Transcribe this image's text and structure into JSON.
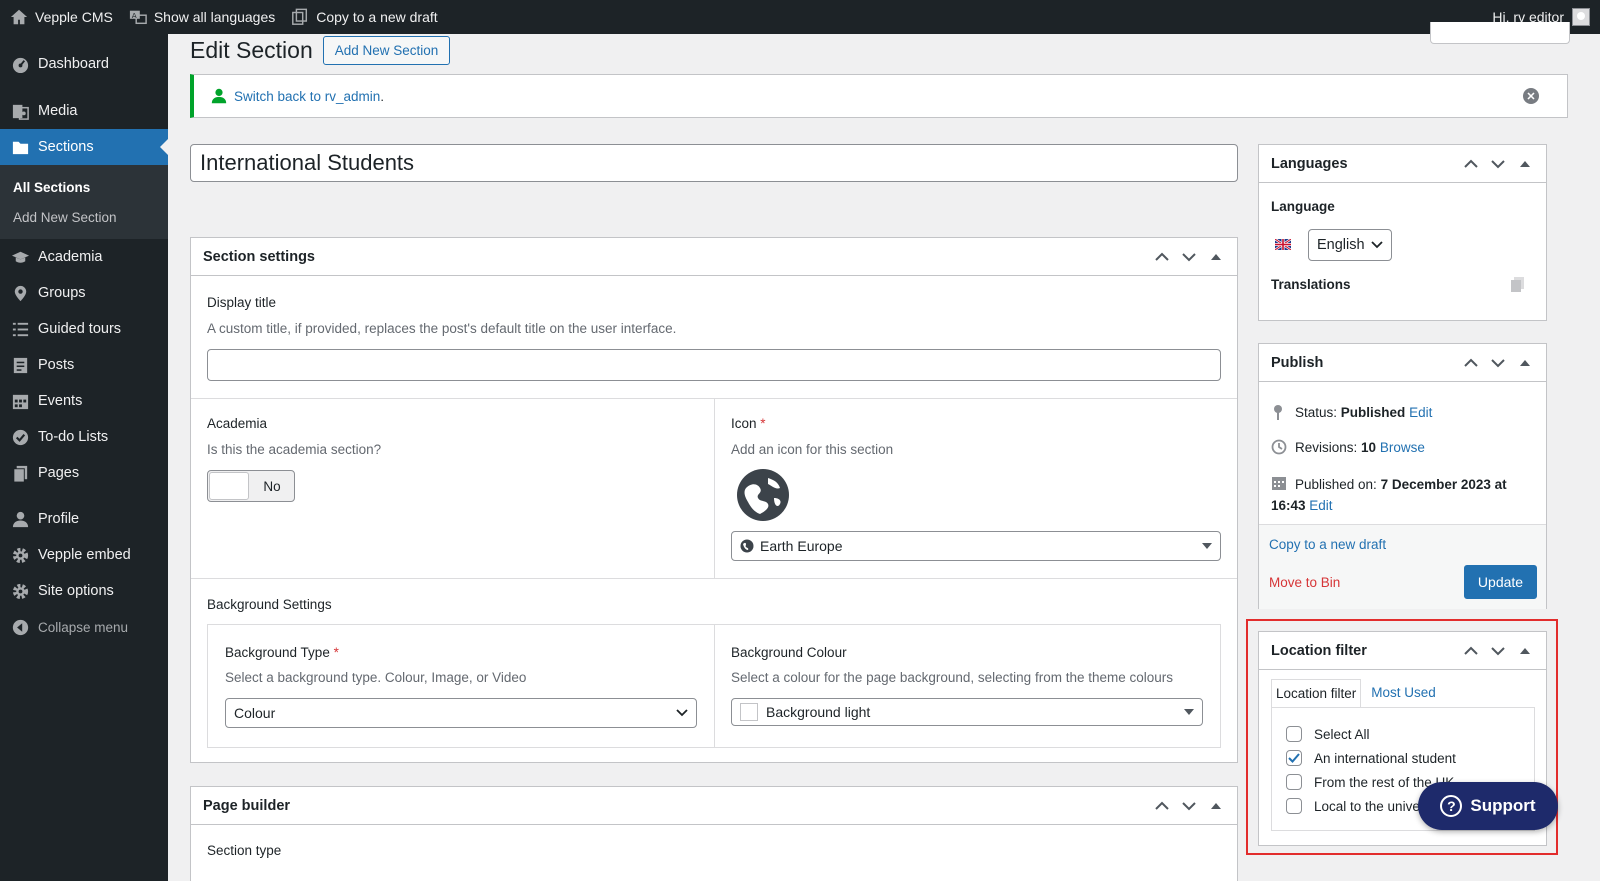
{
  "adminbar": {
    "site_name": "Vepple CMS",
    "languages": "Show all languages",
    "copy_draft": "Copy to a new draft",
    "greeting": "Hi, rv editor"
  },
  "sidebar": {
    "items": [
      {
        "label": "Dashboard",
        "icon": "dashboard-icon"
      },
      {
        "label": "Media",
        "icon": "media-icon"
      },
      {
        "label": "Sections",
        "icon": "folder-icon"
      },
      {
        "label": "Academia",
        "icon": "graduation-cap-icon"
      },
      {
        "label": "Groups",
        "icon": "location-pin-icon"
      },
      {
        "label": "Guided tours",
        "icon": "list-icon"
      },
      {
        "label": "Posts",
        "icon": "posts-icon"
      },
      {
        "label": "Events",
        "icon": "calendar-icon"
      },
      {
        "label": "To-do Lists",
        "icon": "checkmark-icon"
      },
      {
        "label": "Pages",
        "icon": "pages-icon"
      },
      {
        "label": "Profile",
        "icon": "user-icon"
      },
      {
        "label": "Vepple embed",
        "icon": "gear-icon"
      },
      {
        "label": "Site options",
        "icon": "gear-icon"
      }
    ],
    "submenu": [
      "All Sections",
      "Add New Section"
    ],
    "collapse": "Collapse menu"
  },
  "header": {
    "title": "Edit Section",
    "add_new": "Add New Section"
  },
  "notice": {
    "link": "Switch back to rv_admin",
    "suffix": "."
  },
  "post_title": "International Students",
  "section_settings": {
    "title": "Section settings",
    "display_title_label": "Display title",
    "display_title_desc": "A custom title, if provided, replaces the post's default title on the user interface.",
    "display_title_value": "",
    "academia_label": "Academia",
    "academia_desc": "Is this the academia section?",
    "academia_toggle": "No",
    "icon_label": "Icon",
    "icon_required": "*",
    "icon_desc": "Add an icon for this section",
    "icon_value": "Earth Europe",
    "bg_settings_label": "Background Settings",
    "bg_type_label": "Background Type",
    "bg_type_required": "*",
    "bg_type_desc": "Select a background type. Colour, Image, or Video",
    "bg_type_value": "Colour",
    "bg_colour_label": "Background Colour",
    "bg_colour_desc": "Select a colour for the page background, selecting from the theme colours",
    "bg_colour_value": "Background light"
  },
  "page_builder": {
    "title": "Page builder",
    "section_type_label": "Section type"
  },
  "languages_box": {
    "title": "Languages",
    "language_label": "Language",
    "language_value": "English",
    "translations_label": "Translations"
  },
  "publish_box": {
    "title": "Publish",
    "status_label": "Status:",
    "status_value": "Published",
    "status_edit": "Edit",
    "revisions_label": "Revisions:",
    "revisions_value": "10",
    "revisions_browse": "Browse",
    "published_label": "Published on:",
    "published_value": "7 December 2023 at",
    "published_time": "16:43",
    "published_edit": "Edit",
    "copy_draft": "Copy to a new draft",
    "move_to_bin": "Move to Bin",
    "update": "Update"
  },
  "location_filter": {
    "title": "Location filter",
    "tab_all": "Location filter",
    "tab_most_used": "Most Used",
    "options": [
      {
        "label": "Select All",
        "checked": false
      },
      {
        "label": "An international student",
        "checked": true
      },
      {
        "label": "From the rest of the UK",
        "checked": false
      },
      {
        "label": "Local to the university",
        "checked": false
      }
    ]
  },
  "support": {
    "label": "Support"
  },
  "colors": {
    "accent": "#2271b1",
    "admin_bar": "#1d2327",
    "notice_green": "#00a32a",
    "danger": "#d63638",
    "highlight": "#e22c2c",
    "support_bg": "#1e2a6b"
  }
}
